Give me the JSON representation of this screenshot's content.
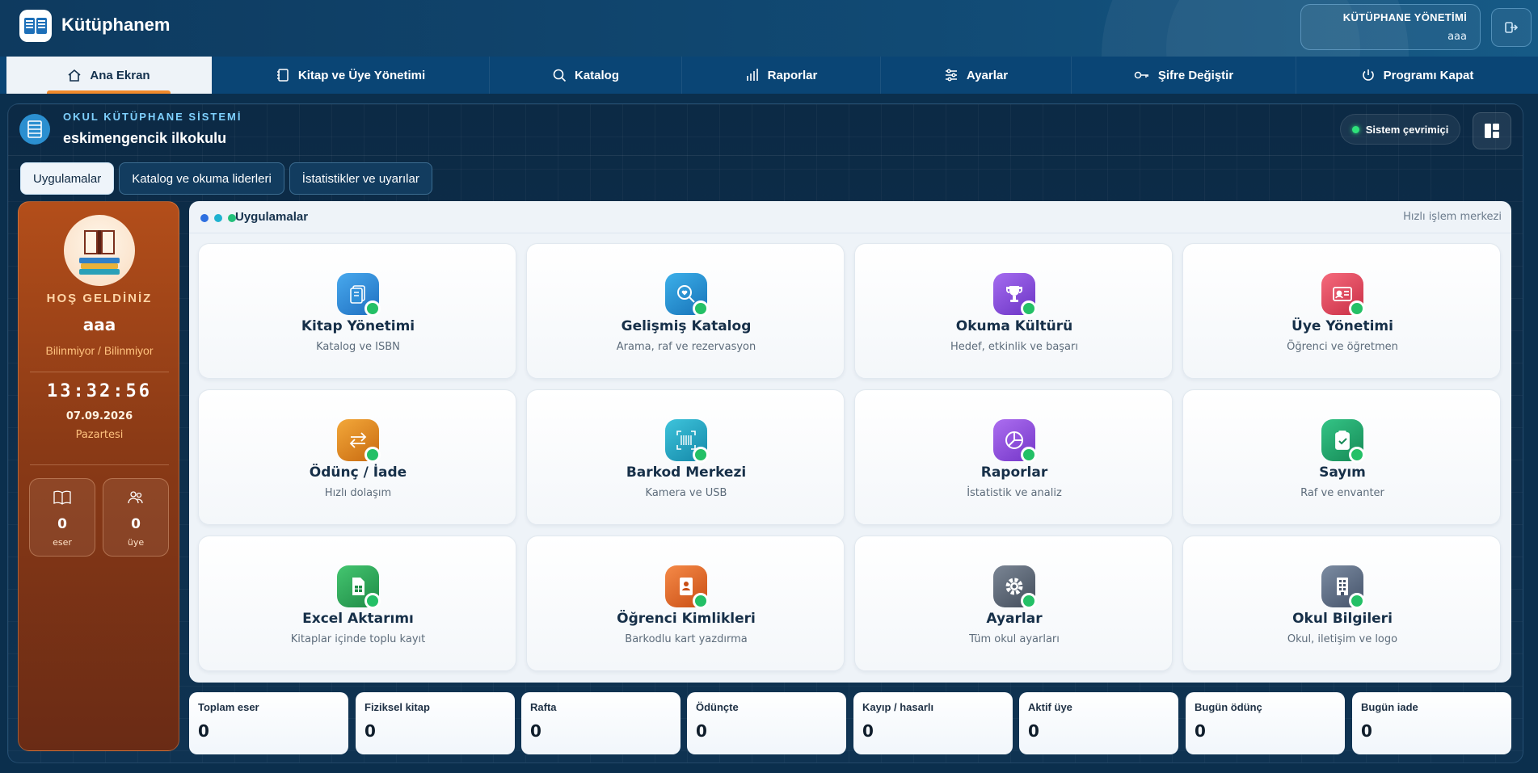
{
  "header": {
    "app_title": "Kütüphanem",
    "admin_title": "KÜTÜPHANE YÖNETİMİ",
    "admin_user": "aaa",
    "logo_icon": "open-book-icon",
    "logout_icon": "logout-icon"
  },
  "nav": {
    "items": [
      {
        "label": "Ana Ekran",
        "icon": "home-icon"
      },
      {
        "label": "Kitap ve Üye Yönetimi",
        "icon": "notebook-icon"
      },
      {
        "label": "Katalog",
        "icon": "search-icon"
      },
      {
        "label": "Raporlar",
        "icon": "bar-chart-icon"
      },
      {
        "label": "Ayarlar",
        "icon": "sliders-icon"
      },
      {
        "label": "Şifre Değiştir",
        "icon": "key-icon"
      },
      {
        "label": "Programı Kapat",
        "icon": "power-icon"
      }
    ],
    "active_index": 0
  },
  "system": {
    "label": "OKUL KÜTÜPHANE SİSTEMİ",
    "school": "eskimengencik ilkokulu",
    "status": "Sistem çevrimiçi",
    "status_color": "#2ee27a"
  },
  "tabs": [
    "Uygulamalar",
    "Katalog ve okuma liderleri",
    "İstatistikler ve uyarılar"
  ],
  "welcome": {
    "greeting": "HOŞ GELDİNİZ",
    "name": "aaa",
    "role": "Bilinmiyor / Bilinmiyor",
    "time": "13:32:56",
    "date": "07.09.2026",
    "day": "Pazartesi",
    "mini": [
      {
        "value": "0",
        "label": "eser",
        "icon": "book-icon"
      },
      {
        "value": "0",
        "label": "üye",
        "icon": "users-icon"
      }
    ]
  },
  "apps": {
    "title": "Uygulamalar",
    "hint": "Hızlı işlem merkezi",
    "items": [
      {
        "title": "Kitap Yönetimi",
        "subtitle": "Katalog ve ISBN",
        "icon": "book-stack-icon",
        "color": "#2f8fd8"
      },
      {
        "title": "Gelişmiş Katalog",
        "subtitle": "Arama, raf ve rezervasyon",
        "icon": "search-heart-icon",
        "color": "#1f8fd0"
      },
      {
        "title": "Okuma Kültürü",
        "subtitle": "Hedef, etkinlik ve başarı",
        "icon": "trophy-icon",
        "color": "#8b4fd9"
      },
      {
        "title": "Üye Yönetimi",
        "subtitle": "Öğrenci ve öğretmen",
        "icon": "id-card-icon",
        "color": "#e24a5e"
      },
      {
        "title": "Ödünç / İade",
        "subtitle": "Hızlı dolaşım",
        "icon": "exchange-icon",
        "color": "#e08a1a"
      },
      {
        "title": "Barkod Merkezi",
        "subtitle": "Kamera ve USB",
        "icon": "barcode-icon",
        "color": "#1ea3c4"
      },
      {
        "title": "Raporlar",
        "subtitle": "İstatistik ve analiz",
        "icon": "pie-chart-icon",
        "color": "#9050d8"
      },
      {
        "title": "Sayım",
        "subtitle": "Raf ve envanter",
        "icon": "clipboard-check-icon",
        "color": "#20a86a"
      },
      {
        "title": "Excel Aktarımı",
        "subtitle": "Kitaplar içinde toplu kayıt",
        "icon": "spreadsheet-icon",
        "color": "#2aa85a"
      },
      {
        "title": "Öğrenci Kimlikleri",
        "subtitle": "Barkodlu kart yazdırma",
        "icon": "badge-icon",
        "color": "#e2682a"
      },
      {
        "title": "Ayarlar",
        "subtitle": "Tüm okul ayarları",
        "icon": "gear-icon",
        "color": "#5b6675"
      },
      {
        "title": "Okul Bilgileri",
        "subtitle": "Okul, iletişim ve logo",
        "icon": "building-icon",
        "color": "#5a6a80"
      }
    ]
  },
  "stats": [
    {
      "label": "Toplam eser",
      "value": "0"
    },
    {
      "label": "Fiziksel kitap",
      "value": "0"
    },
    {
      "label": "Rafta",
      "value": "0"
    },
    {
      "label": "Ödünçte",
      "value": "0"
    },
    {
      "label": "Kayıp / hasarlı",
      "value": "0"
    },
    {
      "label": "Aktif üye",
      "value": "0"
    },
    {
      "label": "Bugün ödünç",
      "value": "0"
    },
    {
      "label": "Bugün iade",
      "value": "0"
    }
  ]
}
